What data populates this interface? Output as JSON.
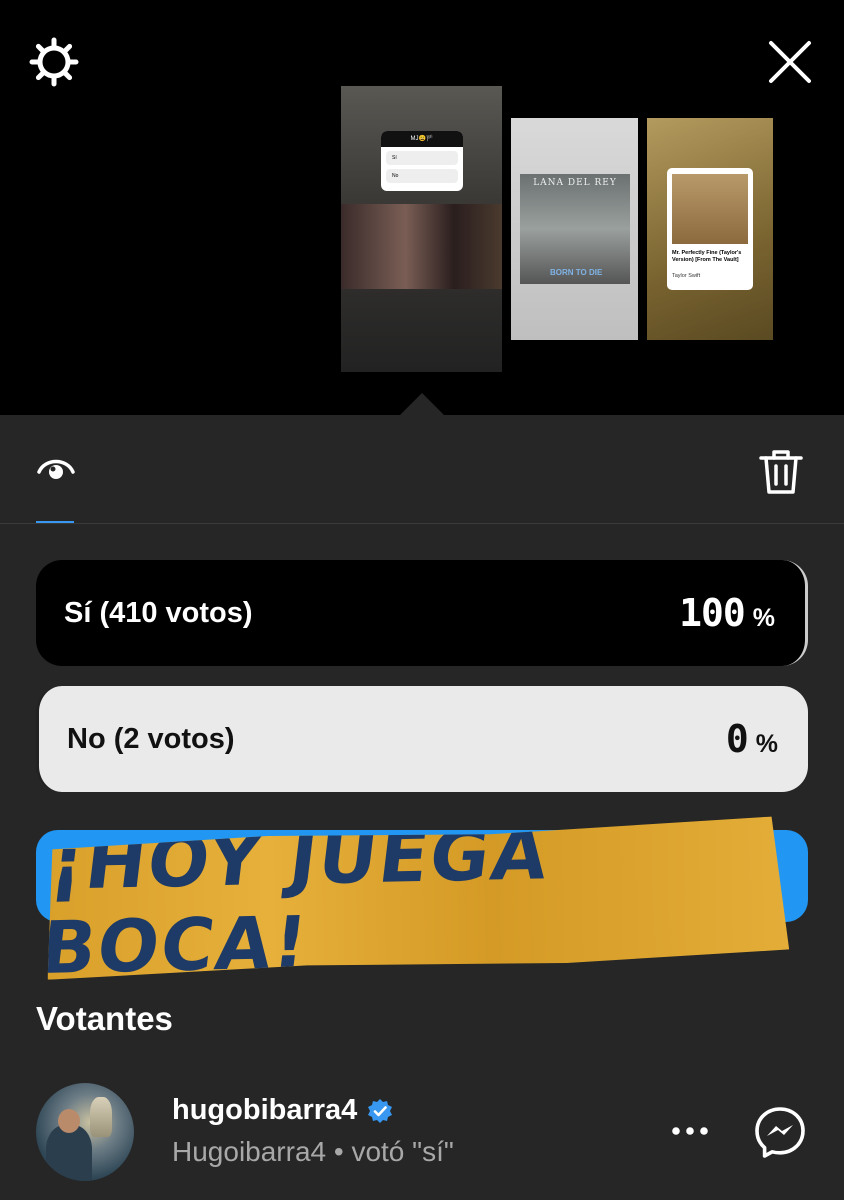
{
  "story_viewer": {
    "thumbnails": [
      {
        "poll_header": "MJ😩🏴",
        "options": [
          "Sí",
          "No"
        ]
      },
      {
        "album_title": "LANA DEL REY",
        "album_subtitle": "BORN TO DIE"
      },
      {
        "song_title": "Mr. Perfectly Fine (Taylor's Version) [From The Vault]",
        "artist": "Taylor Swift"
      }
    ]
  },
  "tabs": {
    "active": "viewers"
  },
  "poll": {
    "options": [
      {
        "label": "Sí (410 votos)",
        "percent_value": "100",
        "percent_sign": "%",
        "fraction": 1.0
      },
      {
        "label": "No (2 votos)",
        "percent_value": "0",
        "percent_sign": "%",
        "fraction": 0.0
      }
    ]
  },
  "banner": {
    "text": "¡HOY JUEGA BOCA!"
  },
  "voters": {
    "title": "Votantes",
    "items": [
      {
        "username": "hugobibarra4",
        "subtitle": "Hugoibarra4 • votó \"sí\"",
        "verified": true
      }
    ]
  },
  "colors": {
    "accent": "#3897f0",
    "panel": "#262626",
    "verified": "#3897f0",
    "banner": "#e3a930",
    "banner_text": "#1e3a66"
  }
}
